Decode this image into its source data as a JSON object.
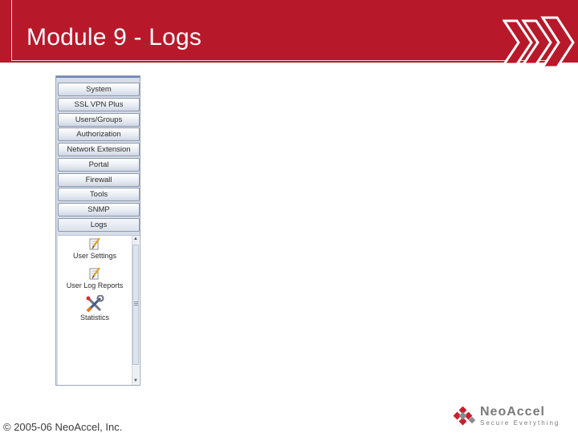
{
  "slide": {
    "title": "Module 9 - Logs",
    "footer": "© 2005-06 NeoAccel, Inc."
  },
  "menu": {
    "items": [
      {
        "label": "System"
      },
      {
        "label": "SSL VPN Plus"
      },
      {
        "label": "Users/Groups"
      },
      {
        "label": "Authorization"
      },
      {
        "label": "Network Extension"
      },
      {
        "label": "Portal"
      },
      {
        "label": "Firewall"
      },
      {
        "label": "Tools"
      },
      {
        "label": "SNMP"
      },
      {
        "label": "Logs",
        "active": true
      }
    ],
    "sub_items": [
      {
        "label": "User Settings",
        "icon": "notepad-pencil-icon"
      },
      {
        "label": "User Log Reports",
        "icon": "notepad-pencil-icon"
      },
      {
        "label": "Statistics",
        "icon": "tools-wrench-icon"
      }
    ]
  },
  "logo": {
    "name": "NeoAccel",
    "tagline": "Secure Everything",
    "icon": "neoaccel-logo-mark"
  },
  "colors": {
    "title_bar": "#b8192a",
    "panel": "#d6dde8",
    "chevron": "#ffffff"
  },
  "decor": {
    "chevron_icon": "triple-chevron-icon"
  }
}
